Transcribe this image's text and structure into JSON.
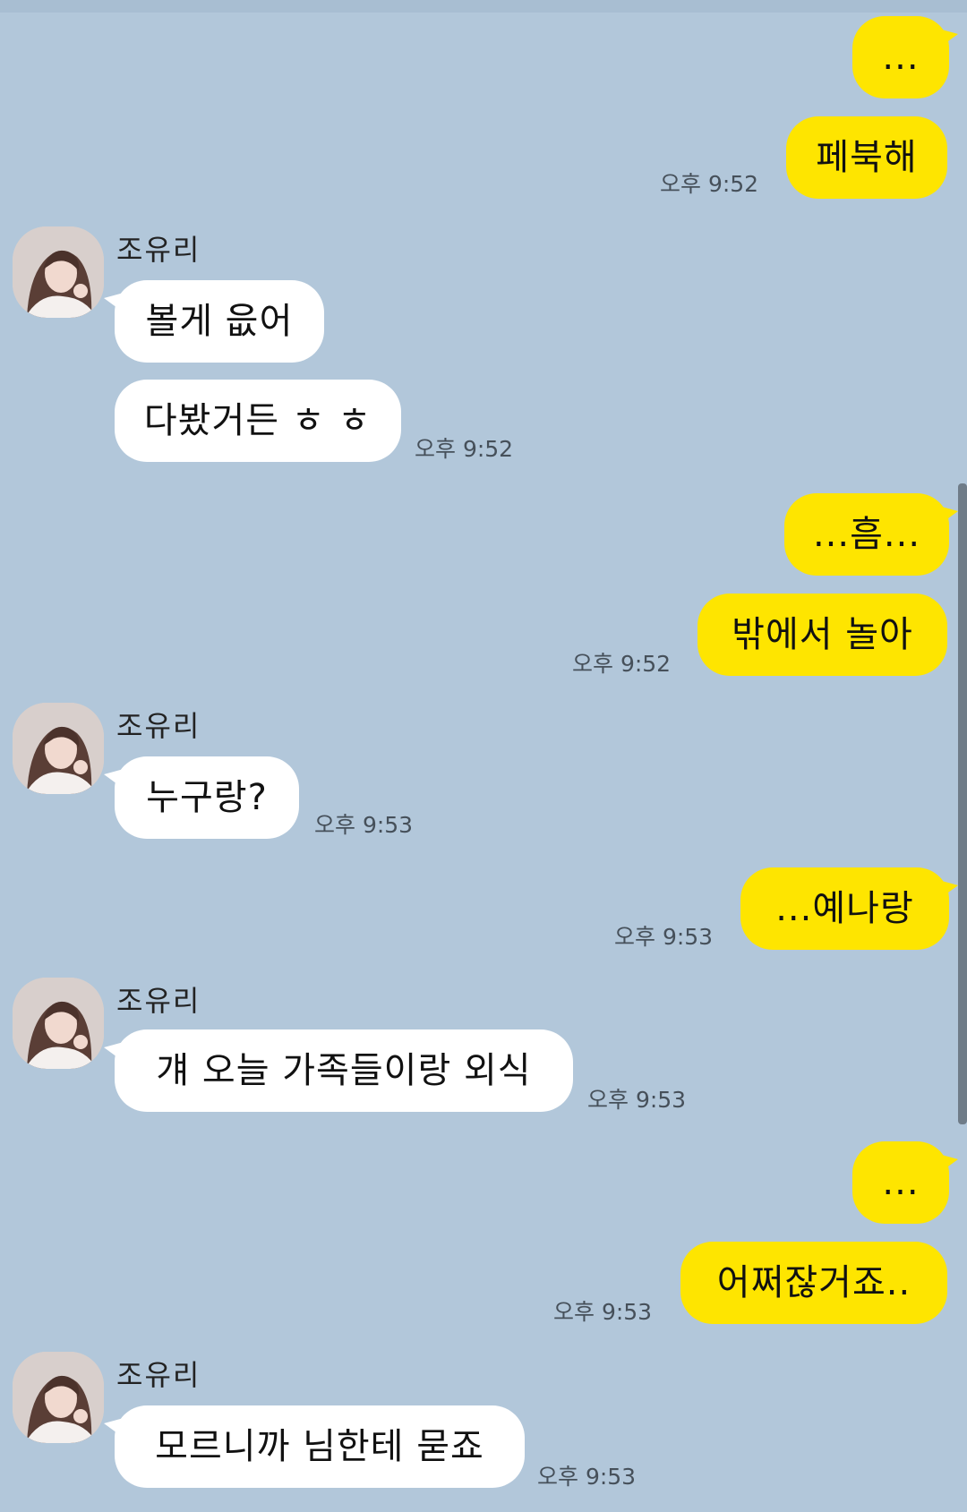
{
  "contact": {
    "name": "조유리"
  },
  "messages": [
    {
      "side": "me",
      "text": "..."
    },
    {
      "side": "me",
      "text": "페북해",
      "time": "오후 9:52"
    },
    {
      "side": "other",
      "text": "볼게 읎어"
    },
    {
      "side": "other",
      "text": "다봤거든 ㅎ ㅎ",
      "time": "오후 9:52"
    },
    {
      "side": "me",
      "text": "...흠..."
    },
    {
      "side": "me",
      "text": "밖에서 놀아",
      "time": "오후 9:52"
    },
    {
      "side": "other",
      "text": "누구랑?",
      "time": "오후 9:53"
    },
    {
      "side": "me",
      "text": "...예나랑",
      "time": "오후 9:53"
    },
    {
      "side": "other",
      "text": "걔 오늘 가족들이랑 외식",
      "time": "오후 9:53"
    },
    {
      "side": "me",
      "text": "..."
    },
    {
      "side": "me",
      "text": "어쩌잖거죠..",
      "time": "오후 9:53"
    },
    {
      "side": "other",
      "text": "모르니까 님한테 묻죠",
      "time": "오후 9:53"
    }
  ],
  "colors": {
    "background": "#b2c7da",
    "my_bubble": "#fee500",
    "their_bubble": "#ffffff"
  },
  "icons": {
    "avatar": "profile-photo"
  }
}
